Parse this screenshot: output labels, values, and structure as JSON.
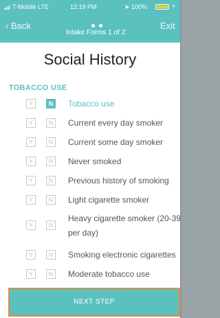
{
  "status_bar": {
    "carrier": "T-Mobile",
    "network": "LTE",
    "time": "12:19 PM",
    "battery": "100%",
    "battery_color": "#f5d020"
  },
  "nav": {
    "back_label": "Back",
    "title": "Intake Forms 1 of 2",
    "exit_label": "Exit",
    "page_dots": 2
  },
  "page_title": "Social History",
  "section_label": "TOBACCO USE",
  "yes_label": "Y",
  "no_label": "N",
  "options": [
    {
      "label": "Tobacco use",
      "answer": "N"
    },
    {
      "label": "Current every day smoker",
      "answer": null
    },
    {
      "label": "Current some day smoker",
      "answer": null
    },
    {
      "label": "Never smoked",
      "answer": null
    },
    {
      "label": "Previous history of smoking",
      "answer": null
    },
    {
      "label": "Light cigarette smoker",
      "answer": null
    },
    {
      "label": "Heavy cigarette smoker (20-39 per day)",
      "answer": null
    },
    {
      "label": "Smoking electronic cigarettes",
      "answer": null
    },
    {
      "label": "Moderate tobacco use",
      "answer": null
    }
  ],
  "next_button": "NEXT STEP",
  "colors": {
    "accent": "#5bc1be",
    "highlight_border": "#e38e3a"
  }
}
